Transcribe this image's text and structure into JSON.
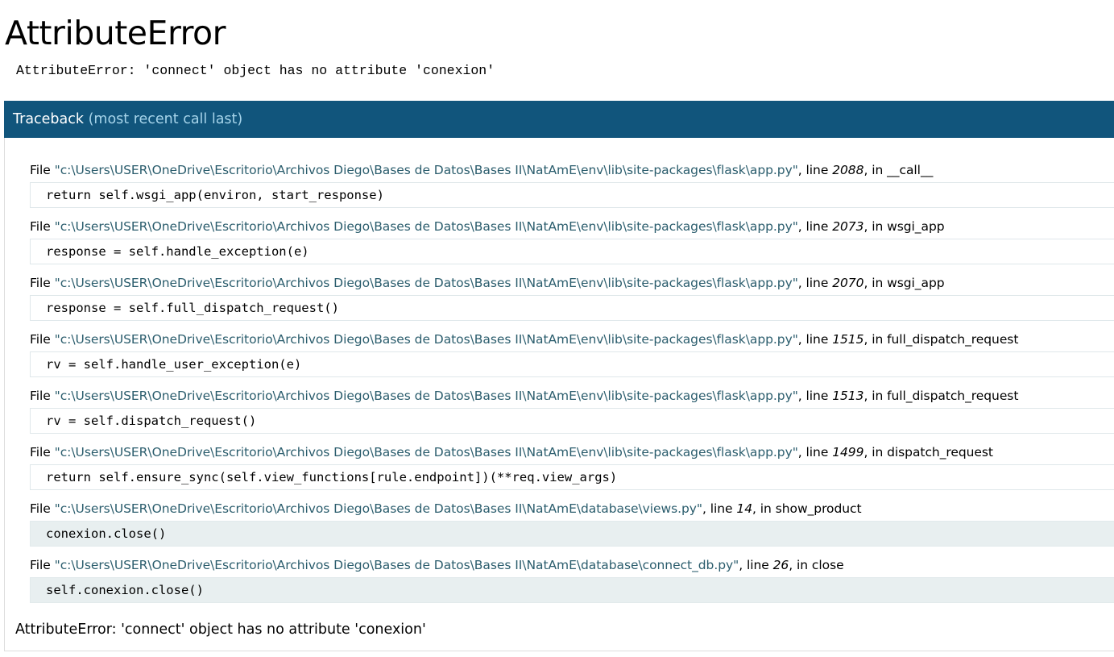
{
  "title": "AttributeError",
  "error_message": "AttributeError: 'connect' object has no attribute 'conexion'",
  "traceback": {
    "label": "Traceback",
    "note": "(most recent call last)",
    "file_prefix": "File ",
    "line_prefix": ", line ",
    "in_prefix": ", in ",
    "frames": [
      {
        "file": "\"c:\\Users\\USER\\OneDrive\\Escritorio\\Archivos Diego\\Bases de Datos\\Bases II\\NatAmE\\env\\lib\\site-packages\\flask\\app.py\"",
        "line": "2088",
        "function": "__call__",
        "source": "return self.wsgi_app(environ, start_response)"
      },
      {
        "file": "\"c:\\Users\\USER\\OneDrive\\Escritorio\\Archivos Diego\\Bases de Datos\\Bases II\\NatAmE\\env\\lib\\site-packages\\flask\\app.py\"",
        "line": "2073",
        "function": "wsgi_app",
        "source": "response = self.handle_exception(e)"
      },
      {
        "file": "\"c:\\Users\\USER\\OneDrive\\Escritorio\\Archivos Diego\\Bases de Datos\\Bases II\\NatAmE\\env\\lib\\site-packages\\flask\\app.py\"",
        "line": "2070",
        "function": "wsgi_app",
        "source": "response = self.full_dispatch_request()"
      },
      {
        "file": "\"c:\\Users\\USER\\OneDrive\\Escritorio\\Archivos Diego\\Bases de Datos\\Bases II\\NatAmE\\env\\lib\\site-packages\\flask\\app.py\"",
        "line": "1515",
        "function": "full_dispatch_request",
        "source": "rv = self.handle_user_exception(e)"
      },
      {
        "file": "\"c:\\Users\\USER\\OneDrive\\Escritorio\\Archivos Diego\\Bases de Datos\\Bases II\\NatAmE\\env\\lib\\site-packages\\flask\\app.py\"",
        "line": "1513",
        "function": "full_dispatch_request",
        "source": "rv = self.dispatch_request()"
      },
      {
        "file": "\"c:\\Users\\USER\\OneDrive\\Escritorio\\Archivos Diego\\Bases de Datos\\Bases II\\NatAmE\\env\\lib\\site-packages\\flask\\app.py\"",
        "line": "1499",
        "function": "dispatch_request",
        "source": "return self.ensure_sync(self.view_functions[rule.endpoint])(**req.view_args)"
      },
      {
        "file": "\"c:\\Users\\USER\\OneDrive\\Escritorio\\Archivos Diego\\Bases de Datos\\Bases II\\NatAmE\\database\\views.py\"",
        "line": "14",
        "function": "show_product",
        "source": "conexion.close()"
      },
      {
        "file": "\"c:\\Users\\USER\\OneDrive\\Escritorio\\Archivos Diego\\Bases de Datos\\Bases II\\NatAmE\\database\\connect_db.py\"",
        "line": "26",
        "function": "close",
        "source": "self.conexion.close()"
      }
    ],
    "final_error": "AttributeError: 'connect' object has no attribute 'conexion'"
  },
  "colors": {
    "header_bg": "#11557c",
    "header_note": "#a6d4ea",
    "filename": "#2b5d6d",
    "app_frame_bg": "#e8eff0"
  }
}
